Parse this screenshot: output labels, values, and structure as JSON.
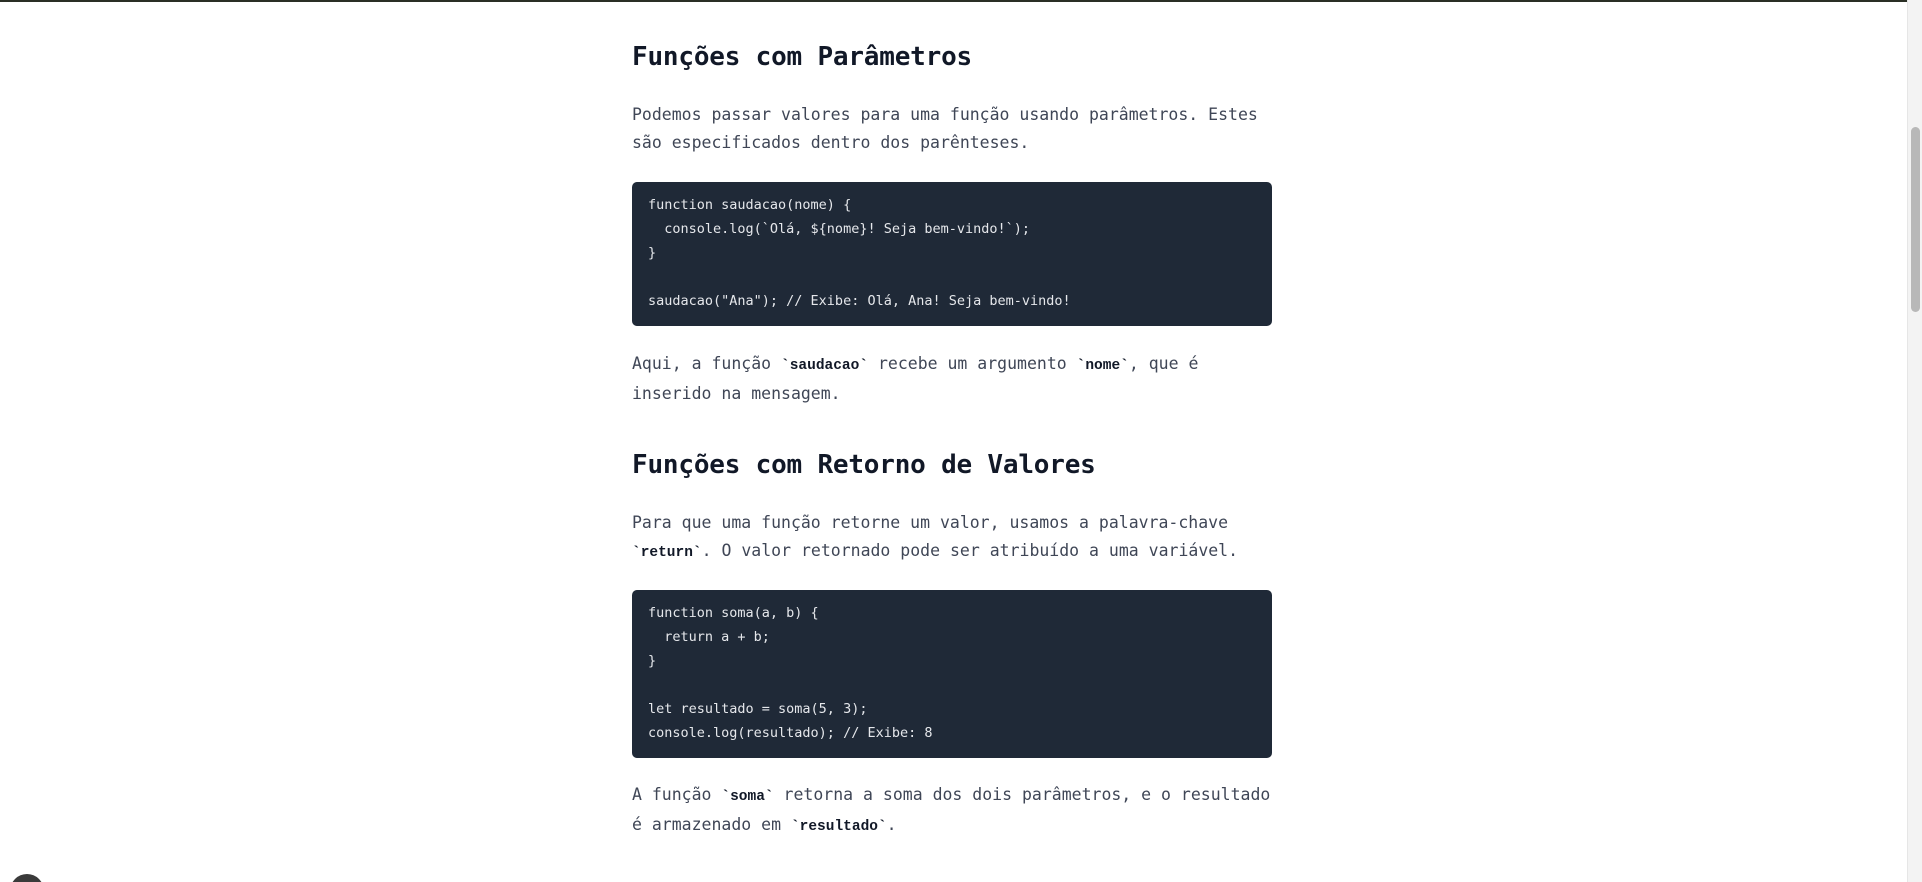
{
  "article": {
    "section1": {
      "heading": "Funções com Parâmetros",
      "intro": "Podemos passar valores para uma função usando parâmetros. Estes são especificados dentro dos parênteses.",
      "code": "function saudacao(nome) {\n  console.log(`Olá, ${nome}! Seja bem-vindo!`);\n}\n\nsaudacao(\"Ana\"); // Exibe: Olá, Ana! Seja bem-vindo!",
      "explanation": {
        "part1": "Aqui, a função ",
        "code1": "`saudacao`",
        "part2": " recebe um argumento ",
        "code2": "`nome`",
        "part3": ", que é inserido na mensagem."
      }
    },
    "section2": {
      "heading": "Funções com Retorno de Valores",
      "intro": {
        "part1": "Para que uma função retorne um valor, usamos a palavra-chave ",
        "code1": "`return`",
        "part2": ". O valor retornado pode ser atribuído a uma variável."
      },
      "code": "function soma(a, b) {\n  return a + b;\n}\n\nlet resultado = soma(5, 3);\nconsole.log(resultado); // Exibe: 8",
      "explanation": {
        "part1": "A função ",
        "code1": "`soma`",
        "part2": " retorna a soma dos dois parâmetros, e o resultado é armazenado em ",
        "code2": "`resultado`",
        "part3": "."
      }
    }
  }
}
